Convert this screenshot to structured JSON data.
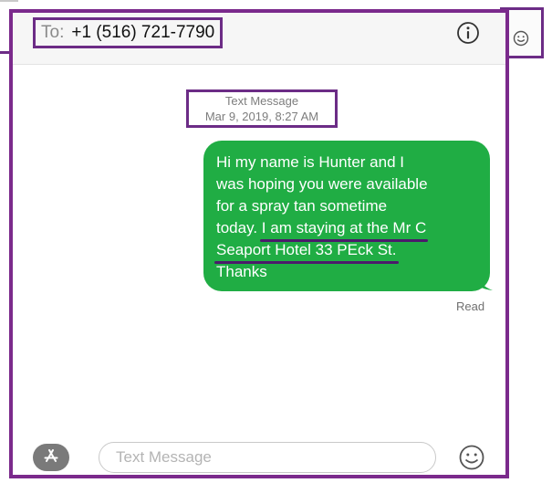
{
  "header": {
    "to_label": "To:",
    "recipient": "+1 (516) 721-7790"
  },
  "conversation": {
    "service": "Text Message",
    "timestamp": "Mar 9, 2019, 8:27 AM",
    "message": {
      "line1": "Hi my name is Hunter and I",
      "line2": "was hoping you were available",
      "line3": "for a spray tan sometime",
      "line4_plain": "today.",
      "line4_highlight": "I am staying at the Mr C",
      "line5_highlight": "Seaport Hotel 33 PEck St.",
      "line6": "Thanks"
    },
    "status": "Read"
  },
  "compose": {
    "placeholder": "Text Message"
  },
  "colors": {
    "bubble": "#20ad44",
    "annotation": "#6c2c86"
  }
}
